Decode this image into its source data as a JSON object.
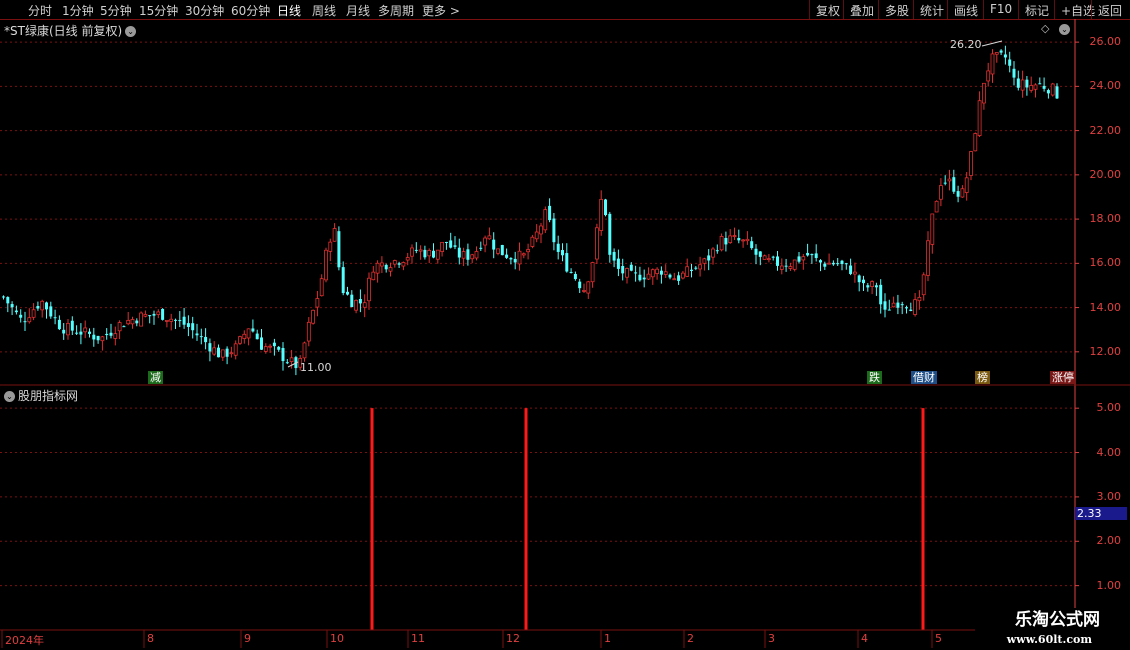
{
  "toolbar": {
    "left_items": [
      {
        "label": "分时"
      },
      {
        "label": "1分钟"
      },
      {
        "label": "5分钟"
      },
      {
        "label": "15分钟"
      },
      {
        "label": "30分钟"
      },
      {
        "label": "60分钟"
      },
      {
        "label": "日线",
        "active": true
      },
      {
        "label": "周线"
      },
      {
        "label": "月线"
      },
      {
        "label": "多周期"
      },
      {
        "label": "更多 >"
      }
    ],
    "right_items": [
      {
        "label": "复权"
      },
      {
        "label": "叠加"
      },
      {
        "label": "多股"
      },
      {
        "label": "统计"
      },
      {
        "label": "画线"
      },
      {
        "label": "F10"
      },
      {
        "label": "标记"
      },
      {
        "label": "+自选"
      },
      {
        "label": "返回"
      }
    ]
  },
  "main_panel": {
    "title": "*ST绿康(日线 前复权)",
    "icons": [
      "chevron-down-icon",
      "diamond-icon"
    ],
    "high_label": "26.20",
    "low_label": "11.00",
    "y_ticks": [
      "26.00",
      "24.00",
      "22.00",
      "20.00",
      "18.00",
      "16.00",
      "14.00",
      "12.00"
    ],
    "events": [
      {
        "label": "减",
        "bg": "#1c6b1c",
        "color": "#ffffff"
      },
      {
        "label": "跌",
        "bg": "#1c6b1c",
        "color": "#ffffff"
      },
      {
        "label": "借财",
        "bg": "#1f4f86",
        "color": "#ffffff"
      },
      {
        "label": "榜",
        "bg": "#7a5a10",
        "color": "#ffffff"
      },
      {
        "label": "涨停",
        "bg": "#7a1818",
        "color": "#ffffff"
      }
    ]
  },
  "indicator_panel": {
    "title": "股朋指标网",
    "y_ticks": [
      "5.00",
      "4.00",
      "3.00",
      "2.00",
      "1.00"
    ],
    "current_value": "2.33"
  },
  "x_axis": [
    "2024年",
    "8",
    "9",
    "10",
    "11",
    "12",
    "1",
    "2",
    "3",
    "4",
    "5"
  ],
  "watermark": {
    "line1": "乐淘公式网",
    "line2": "www.60lt.com"
  },
  "colors": {
    "up": "#e03030",
    "down": "#54ffff",
    "axis": "#e04040",
    "grid": "#7a1010",
    "signal": "#ff1a1a"
  },
  "chart_data": {
    "type": "candlestick",
    "title": "*ST绿康(日线 前复权)",
    "ylim": [
      10.5,
      27.0
    ],
    "categories": [
      "2024年",
      "8",
      "9",
      "10",
      "11",
      "12",
      "1",
      "2",
      "3",
      "4",
      "5"
    ],
    "high_mark": 26.2,
    "low_mark": 11.0,
    "series": [
      {
        "name": "股朋指标网",
        "type": "bar",
        "ylim": [
          0,
          5.5
        ],
        "values": [
          5.0,
          5.0,
          5.0
        ],
        "current": 2.33
      }
    ]
  }
}
